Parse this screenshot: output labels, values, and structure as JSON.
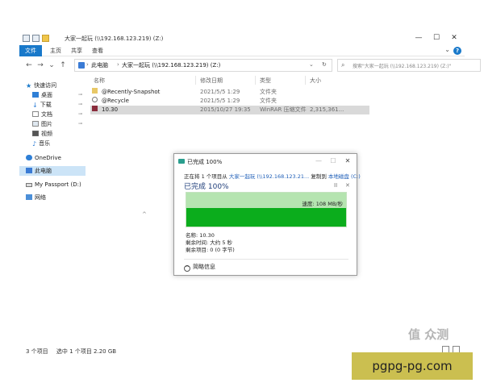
{
  "window": {
    "title": "大家一起玩 (\\\\192.168.123.219) (Z:)",
    "minimize": "—",
    "maximize": "☐",
    "close": "✕"
  },
  "ribbon": {
    "tabs": [
      "文件",
      "主页",
      "共享",
      "查看"
    ],
    "help": "?"
  },
  "nav": {
    "back": "←",
    "forward": "→",
    "recent": "⌄",
    "up": "↑",
    "breadcrumb": [
      "此电脑",
      "大家一起玩 (\\\\192.168.123.219) (Z:)"
    ],
    "refresh": "↻",
    "search_placeholder": "搜索\"大家一起玩 (\\\\192.168.123.219) (Z:)\""
  },
  "sidebar": {
    "items": [
      {
        "label": "快速访问",
        "icon": "star-icon",
        "pinned": false
      },
      {
        "label": "桌面",
        "icon": "desktop-icon",
        "pinned": true
      },
      {
        "label": "下载",
        "icon": "download-icon",
        "pinned": true
      },
      {
        "label": "文档",
        "icon": "documents-icon",
        "pinned": true
      },
      {
        "label": "图片",
        "icon": "pictures-icon",
        "pinned": true
      },
      {
        "label": "视频",
        "icon": "videos-icon",
        "pinned": false
      },
      {
        "label": "音乐",
        "icon": "music-icon",
        "pinned": false
      },
      {
        "label": "OneDrive",
        "icon": "cloud-icon",
        "pinned": false
      },
      {
        "label": "此电脑",
        "icon": "computer-icon",
        "pinned": false
      },
      {
        "label": "My Passport (D:)",
        "icon": "drive-icon",
        "pinned": false
      },
      {
        "label": "网络",
        "icon": "network-icon",
        "pinned": false
      }
    ],
    "pin_glyph": "📌"
  },
  "columns": [
    "名称",
    "修改日期",
    "类型",
    "大小"
  ],
  "files": [
    {
      "name": "@Recently-Snapshot",
      "date": "2021/5/5 1:29",
      "type": "文件夹",
      "size": "",
      "icon": "folder-snapshot-icon"
    },
    {
      "name": "@Recycle",
      "date": "2021/5/5 1:29",
      "type": "文件夹",
      "size": "",
      "icon": "folder-recycle-icon"
    },
    {
      "name": "10.30",
      "date": "2015/10/27 19:35",
      "type": "WinRAR 压缩文件",
      "size": "2,315,361...",
      "icon": "winrar-icon"
    }
  ],
  "sort_indicator": "^",
  "status": {
    "count": "3 个项目",
    "selected": "选中 1 个项目  2.20 GB"
  },
  "dialog": {
    "title": "已完成 100%",
    "line_prefix": "正在将 1 个项目从",
    "source": "大家一起玩 (\\\\192.168.123.21...",
    "line_mid": "复制到",
    "dest": "本地磁盘 (C:)",
    "progress_text": "已完成 100%",
    "pause": "II",
    "cancel": "✕",
    "speed": "速度: 108 MB/秒",
    "name_line": "名称: 10.30",
    "remaining_time": "剩余时间: 大约 5 秒",
    "remaining_items": "剩余项目: 0 (0 字节)",
    "less_details": "简略信息",
    "less_glyph": "^",
    "progress": 1.0,
    "graph_level": 0.55
  },
  "watermark": {
    "site": "pgpg-pg.com",
    "logo": "值 众测"
  },
  "colors": {
    "accent": "#1979ca",
    "graph_bg": "#b5e4b0",
    "graph_fill": "#0bad1c",
    "selected_row": "#d9d9d9",
    "link": "#1f5fb8"
  }
}
